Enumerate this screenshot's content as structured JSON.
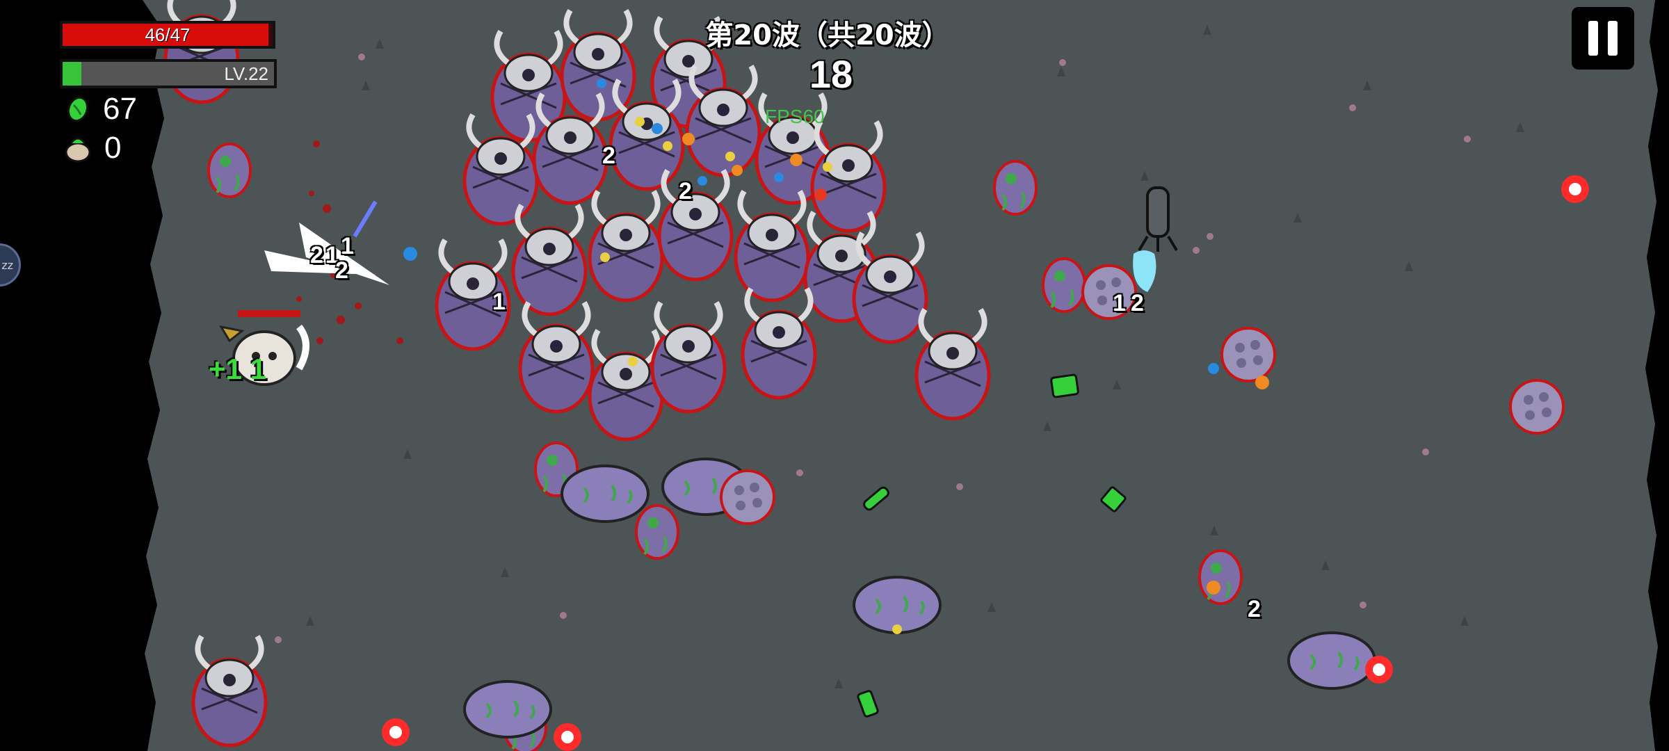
{
  "hud": {
    "hp_text": "46/47",
    "hp_fraction": 0.979,
    "level_text": "LV.22",
    "xp_fraction": 0.09,
    "materials_count": "67",
    "bag_count": "0",
    "wave_title": "第20波（共20波）",
    "timer": "18",
    "fps": "FPS60",
    "zz_label": "zz"
  },
  "damage_numbers": [
    "2",
    "2",
    "1",
    "2",
    "1",
    "2",
    "1",
    "1",
    "2",
    "2"
  ],
  "heal_text": "+1",
  "heal_text2": "1",
  "colors": {
    "ground": "#4c5456",
    "border": "#000000",
    "hp": "#d90c0c",
    "xp": "#37c43a",
    "enemy_body": "#6e5f98",
    "enemy_outline": "#c81414",
    "material": "#36d13a",
    "projectile": "#ff2a2a"
  },
  "icons": [
    "pause-icon",
    "material-icon",
    "bag-icon",
    "zz-icon"
  ]
}
